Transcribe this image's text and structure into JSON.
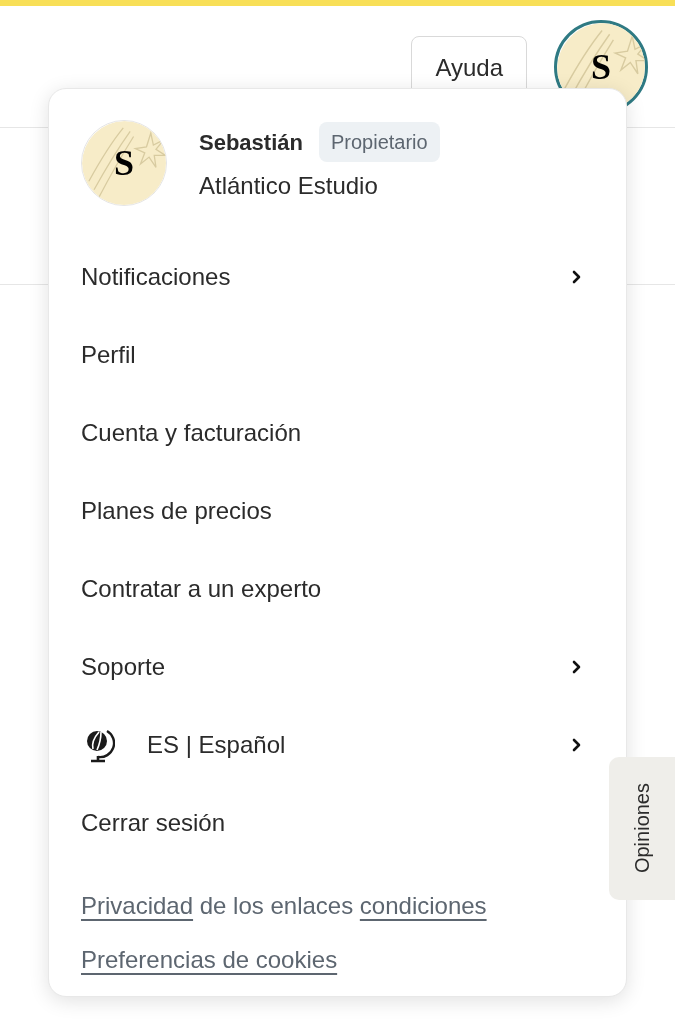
{
  "header": {
    "help_button": "Ayuda",
    "avatar": {
      "initial": "S",
      "selected": true
    }
  },
  "menu": {
    "profile": {
      "initial": "S",
      "name": "Sebastián",
      "role": "Propietario",
      "organization": "Atlántico Estudio"
    },
    "items": [
      {
        "kind": "submenu",
        "label": "Notificaciones"
      },
      {
        "kind": "link",
        "label": "Perfil"
      },
      {
        "kind": "link",
        "label": "Cuenta y facturación"
      },
      {
        "kind": "link",
        "label": "Planes de precios"
      },
      {
        "kind": "link",
        "label": "Contratar a un experto"
      },
      {
        "kind": "submenu",
        "label": "Soporte"
      },
      {
        "kind": "language",
        "label": "ES | Español"
      },
      {
        "kind": "link",
        "label": "Cerrar sesión"
      }
    ],
    "footer_lines": [
      [
        {
          "text": "Privacidad",
          "link": true
        },
        {
          "text": " de los enlaces ",
          "link": false
        },
        {
          "text": "condiciones",
          "link": true
        }
      ],
      [
        {
          "text": "Preferencias de cookies",
          "link": true
        }
      ]
    ]
  },
  "feedback_tab": "Opiniones"
}
